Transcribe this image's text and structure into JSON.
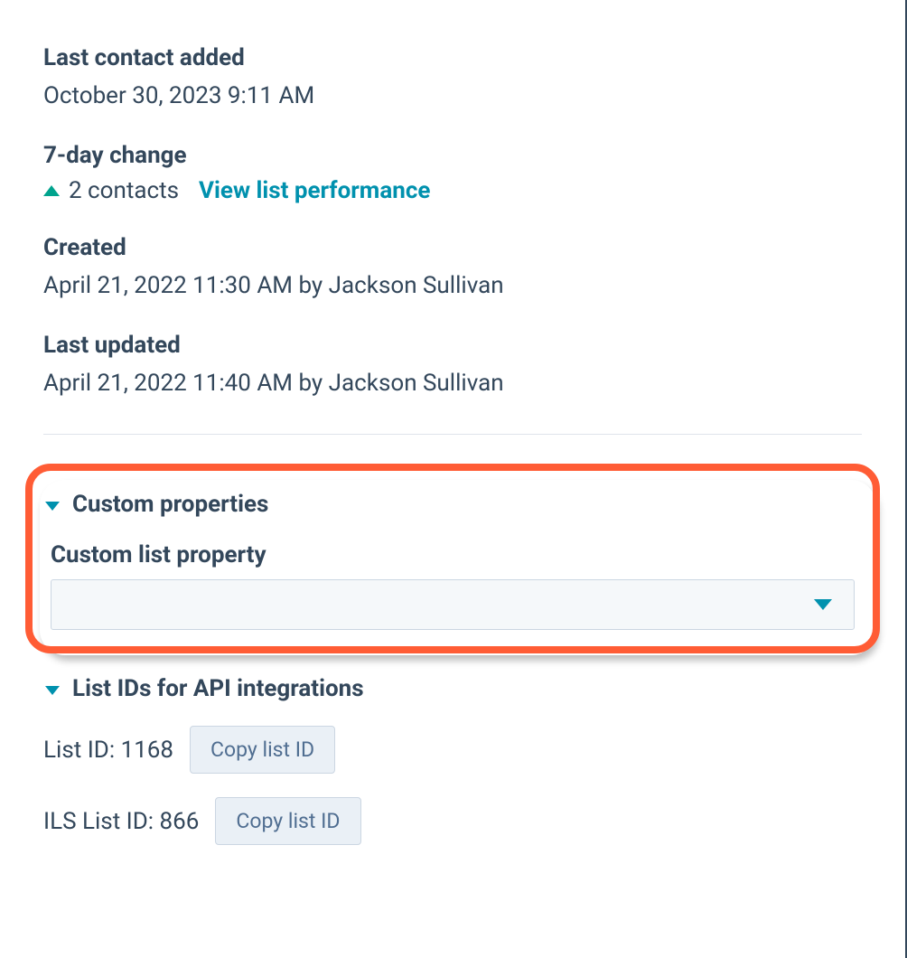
{
  "last_contact_added": {
    "label": "Last contact added",
    "value": "October 30, 2023 9:11 AM"
  },
  "seven_day_change": {
    "label": "7-day change",
    "value": "2 contacts",
    "link_text": "View list performance"
  },
  "created": {
    "label": "Created",
    "value": "April 21, 2022 11:30 AM by Jackson Sullivan"
  },
  "last_updated": {
    "label": "Last updated",
    "value": "April 21, 2022 11:40 AM by Jackson Sullivan"
  },
  "custom_properties": {
    "header": "Custom properties",
    "field_label": "Custom list property",
    "selected_value": ""
  },
  "list_ids": {
    "header": "List IDs for API integrations",
    "list_id_label": "List ID: 1168",
    "ils_list_id_label": "ILS List ID: 866",
    "copy_button_label": "Copy list ID"
  }
}
